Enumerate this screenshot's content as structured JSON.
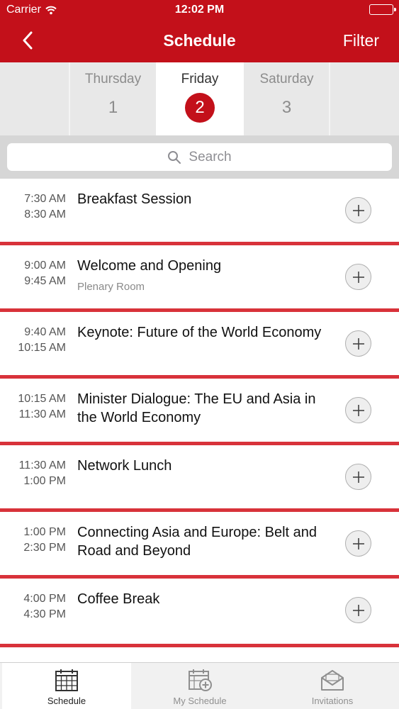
{
  "status_bar": {
    "carrier": "Carrier",
    "time": "12:02 PM"
  },
  "nav": {
    "title": "Schedule",
    "filter_label": "Filter"
  },
  "days": [
    {
      "name": "Thursday",
      "number": "1",
      "selected": false
    },
    {
      "name": "Friday",
      "number": "2",
      "selected": true
    },
    {
      "name": "Saturday",
      "number": "3",
      "selected": false
    }
  ],
  "search": {
    "placeholder": "Search"
  },
  "sessions": [
    {
      "start": "7:30 AM",
      "end": "8:30 AM",
      "title": "Breakfast Session",
      "location": ""
    },
    {
      "start": "9:00 AM",
      "end": "9:45 AM",
      "title": "Welcome and Opening",
      "location": "Plenary Room"
    },
    {
      "start": "9:40 AM",
      "end": "10:15 AM",
      "title": "Keynote: Future of the World Economy",
      "location": ""
    },
    {
      "start": "10:15 AM",
      "end": "11:30 AM",
      "title": "Minister Dialogue: The EU and Asia in the World Economy",
      "location": ""
    },
    {
      "start": "11:30 AM",
      "end": "1:00 PM",
      "title": "Network Lunch",
      "location": ""
    },
    {
      "start": "1:00 PM",
      "end": "2:30 PM",
      "title": "Connecting Asia and Europe: Belt and Road and Beyond",
      "location": ""
    },
    {
      "start": "4:00 PM",
      "end": "4:30 PM",
      "title": "Coffee Break",
      "location": ""
    }
  ],
  "tabs": [
    {
      "label": "Schedule",
      "icon": "calendar-icon",
      "active": true
    },
    {
      "label": "My Schedule",
      "icon": "calendar-add-icon",
      "active": false
    },
    {
      "label": "Invitations",
      "icon": "envelope-icon",
      "active": false
    }
  ],
  "colors": {
    "brand": "#c3101a",
    "separator": "#d8323a"
  }
}
